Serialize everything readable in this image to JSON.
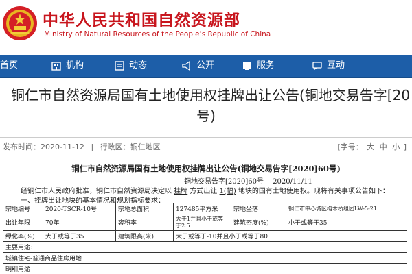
{
  "site": {
    "name_cn": "中华人民共和国自然资源部",
    "name_en": "Ministry of Natural Resources of the People’s Republic of China"
  },
  "nav": [
    {
      "label": "首页",
      "icon": "home-icon"
    },
    {
      "label": "机构",
      "icon": "building-icon"
    },
    {
      "label": "动态",
      "icon": "news-icon"
    },
    {
      "label": "公开",
      "icon": "megaphone-icon"
    },
    {
      "label": "服务",
      "icon": "service-icon"
    },
    {
      "label": "互动",
      "icon": "chat-icon"
    }
  ],
  "article": {
    "title_line1": "铜仁市自然资源局国有土地使用权挂牌出让公告(铜地交易告字[20",
    "title_line2": "号)",
    "publish": "发布时间：2020-11-12",
    "separator": "|",
    "region": "行政区：铜仁地区",
    "fontsize_label": "[字号：",
    "fontsize_large": "大",
    "fontsize_medium": "中",
    "fontsize_small": "小",
    "fontsize_end": "]"
  },
  "doc": {
    "title": "铜仁市自然资源局国有土地使用权挂牌出让公告(铜地交易告字[2020]60号)",
    "code": "铜地交易告字[2020]60号",
    "date": "2020/11/11",
    "para_prefix": "经铜仁市人民政府批准，铜仁市自然资源局决定以",
    "para_method": "挂牌",
    "para_mid": "方式出让",
    "para_count": "1(幅)",
    "para_suffix": "地块的国有土地使用权。现将有关事项公告如下：",
    "section1": "一、挂牌出让地块的基本情况和规划指标要求："
  },
  "table": {
    "r1": [
      "宗地编号",
      "2020-TSCR-10号",
      "宗地总面积",
      "127485平方米",
      "宗地坐落",
      "铜仁市中心城区榕木桥组团LW-5-21"
    ],
    "r2": [
      "出让年限",
      "70年",
      "容积率",
      "大于1并且小于或等于2.5",
      "建筑密度(%)",
      "小于或等于35"
    ],
    "r3": [
      "绿化率(%)",
      "大于或等于35",
      "建筑限高(米)",
      "大于或等于-10并且小于或等于80"
    ],
    "r4": [
      "主要用途:"
    ],
    "r5": [
      "城镇住宅-普通商品住房用地"
    ],
    "r6": [
      "明细用途"
    ]
  }
}
